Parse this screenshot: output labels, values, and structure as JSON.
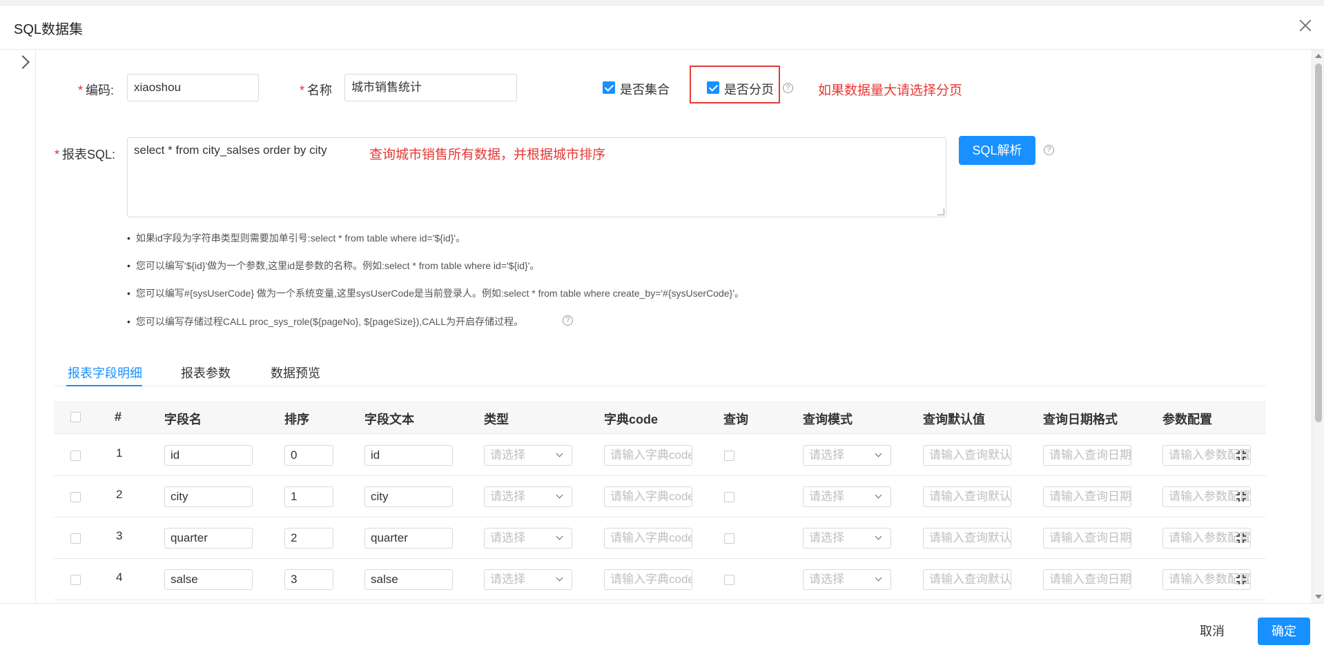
{
  "dialog": {
    "title": "SQL数据集"
  },
  "form": {
    "code_label": "编码:",
    "code_value": "xiaoshou",
    "name_label": "名称",
    "name_value": "城市销售统计",
    "is_collection_label": "是否集合",
    "is_paging_label": "是否分页",
    "paging_annotation": "如果数据量大请选择分页",
    "sql_label": "报表SQL:",
    "sql_value": "select * from city_salses order by city",
    "sql_annotation": "查询城市销售所有数据，并根据城市排序",
    "parse_button": "SQL解析",
    "help_symbol": "?"
  },
  "tips": [
    "如果id字段为字符串类型则需要加单引号:select * from table where id='${id}'。",
    "您可以编写'${id}'做为一个参数,这里id是参数的名称。例如:select * from table where id='${id}'。",
    "您可以编写#{sysUserCode} 做为一个系统变量,这里sysUserCode是当前登录人。例如:select * from table where create_by='#{sysUserCode}'。",
    "您可以编写存储过程CALL proc_sys_role(${pageNo}, ${pageSize}),CALL为开启存储过程。"
  ],
  "tabs": [
    "报表字段明细",
    "报表参数",
    "数据预览"
  ],
  "table": {
    "headers": [
      "#",
      "字段名",
      "排序",
      "字段文本",
      "类型",
      "字典code",
      "查询",
      "查询模式",
      "查询默认值",
      "查询日期格式",
      "参数配置"
    ],
    "placeholders": {
      "type": "请选择",
      "dict": "请输入字典code",
      "mode": "请选择",
      "default": "请输入查询默认值",
      "date_format": "请输入查询日期格式",
      "param": "请输入参数配置"
    },
    "rows": [
      {
        "num": "1",
        "field": "id",
        "order": "0",
        "text": "id"
      },
      {
        "num": "2",
        "field": "city",
        "order": "1",
        "text": "city"
      },
      {
        "num": "3",
        "field": "quarter",
        "order": "2",
        "text": "quarter"
      },
      {
        "num": "4",
        "field": "salse",
        "order": "3",
        "text": "salse"
      }
    ]
  },
  "footer": {
    "cancel": "取消",
    "ok": "确定"
  },
  "colors": {
    "primary": "#1890ff",
    "annotation_red": "#e53935"
  }
}
